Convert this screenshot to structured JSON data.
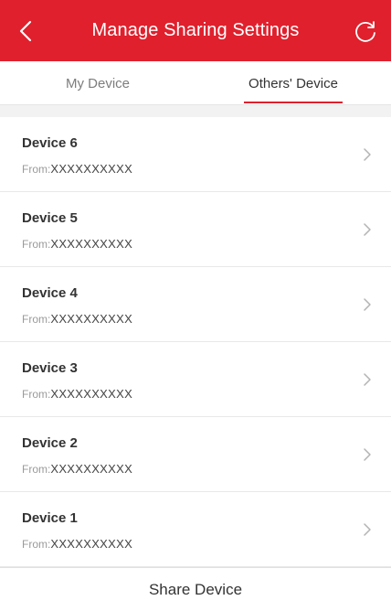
{
  "header": {
    "title": "Manage Sharing Settings",
    "back_icon": "chevron-left-icon",
    "refresh_icon": "refresh-icon",
    "color": "#e0202d"
  },
  "tabs": [
    {
      "label": "My Device",
      "active": false
    },
    {
      "label": "Others' Device",
      "active": true
    }
  ],
  "devices": [
    {
      "name": "Device 6",
      "from_label": "From:",
      "from_value": "XXXXXXXXXX"
    },
    {
      "name": "Device 5",
      "from_label": "From:",
      "from_value": "XXXXXXXXXX"
    },
    {
      "name": "Device 4",
      "from_label": "From:",
      "from_value": "XXXXXXXXXX"
    },
    {
      "name": "Device 3",
      "from_label": "From:",
      "from_value": "XXXXXXXXXX"
    },
    {
      "name": "Device 2",
      "from_label": "From:",
      "from_value": "XXXXXXXXXX"
    },
    {
      "name": "Device 1",
      "from_label": "From:",
      "from_value": "XXXXXXXXXX"
    }
  ],
  "footer": {
    "share_label": "Share Device"
  }
}
